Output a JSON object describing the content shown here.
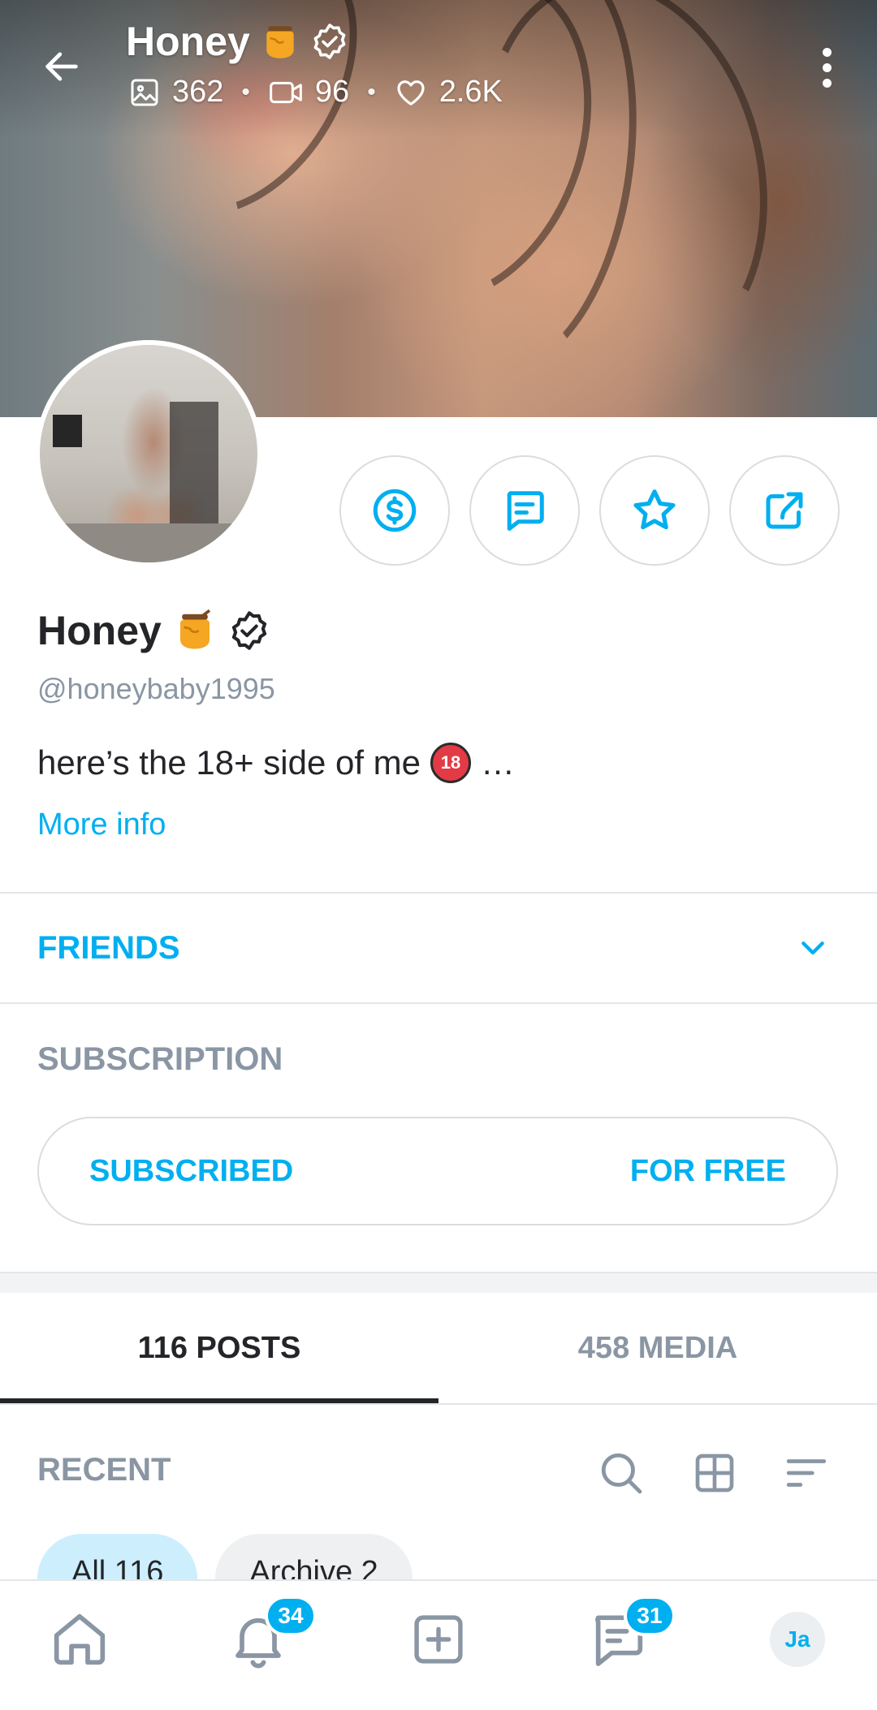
{
  "header": {
    "title": "Honey",
    "stats": {
      "photos": "362",
      "videos": "96",
      "likes": "2.6K"
    },
    "separator": "•"
  },
  "profile": {
    "name": "Honey",
    "handle": "@honeybaby1995",
    "bio": "here’s the 18+ side of me",
    "bio_ellipsis": "…",
    "more_info": "More info",
    "under18_badge": "18"
  },
  "actions": [
    {
      "icon": "dollar-icon"
    },
    {
      "icon": "message-icon"
    },
    {
      "icon": "star-icon"
    },
    {
      "icon": "share-icon"
    }
  ],
  "friends": {
    "label": "FRIENDS"
  },
  "subscription": {
    "label": "SUBSCRIPTION",
    "status": "SUBSCRIBED",
    "price": "FOR FREE"
  },
  "tabs": [
    {
      "label": "116 POSTS",
      "active": true
    },
    {
      "label": "458 MEDIA",
      "active": false
    }
  ],
  "feed": {
    "section_label": "RECENT",
    "chips": [
      {
        "label": "All 116",
        "active": true
      },
      {
        "label": "Archive 2",
        "active": false
      }
    ]
  },
  "bottom_nav": {
    "notifications_count": "34",
    "messages_count": "31",
    "user_initials": "Ja"
  },
  "colors": {
    "accent": "#00aff0",
    "muted": "#8a96a3",
    "text": "#242529",
    "border": "#d9dde0"
  }
}
